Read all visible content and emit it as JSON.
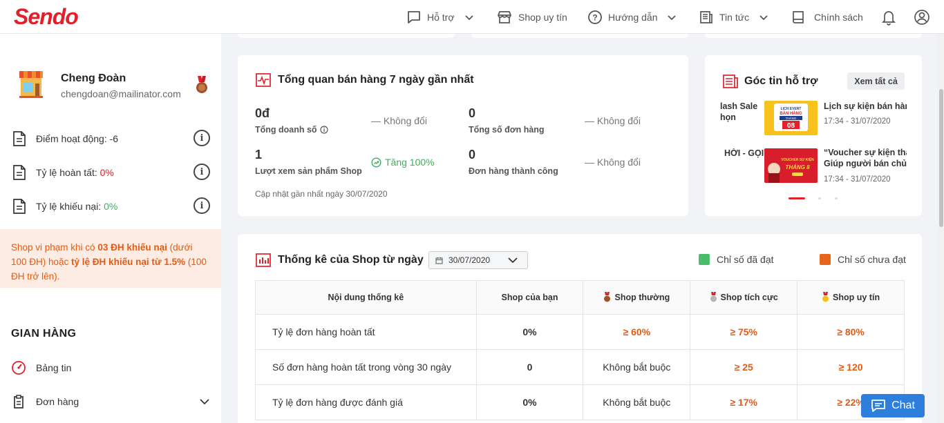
{
  "brand": {
    "logo": "Sendo"
  },
  "header": {
    "nav": [
      {
        "label": "Hỗ trợ"
      },
      {
        "label": "Shop uy tín"
      },
      {
        "label": "Hướng dẫn"
      },
      {
        "label": "Tin tức"
      },
      {
        "label": "Chính sách"
      }
    ]
  },
  "profile": {
    "name": "Cheng Đoàn",
    "email": "chengdoan@mailinator.com"
  },
  "stats": {
    "activity_label": "Điểm hoạt động: ",
    "activity_value": "-6",
    "completion_label": "Tỷ lệ hoàn tất: ",
    "completion_value": "0%",
    "complaint_label": "Tỷ lệ khiếu nại: ",
    "complaint_value": "0%"
  },
  "warning": {
    "p1": "Shop vi phạm khi có ",
    "b1": "03 ĐH khiếu nại",
    "p2": " (dưới 100 ĐH) hoặc ",
    "b2": "tỷ lệ ĐH khiếu nại từ 1.5%",
    "p3": " (100 ĐH trở lên)."
  },
  "sidebar_menu": {
    "section": "GIAN HÀNG",
    "items": [
      {
        "label": "Bảng tin"
      },
      {
        "label": "Đơn hàng"
      }
    ]
  },
  "overview": {
    "title": "Tổng quan bán hàng 7 ngày gần nhất",
    "metrics": [
      {
        "value": "0đ",
        "label": "Tổng doanh số",
        "trend": "— Không đổi"
      },
      {
        "value": "0",
        "label": "Tổng số đơn hàng",
        "trend": "— Không đổi"
      },
      {
        "value": "1",
        "label": "Lượt xem sản phẩm Shop",
        "trend": "Tăng 100%"
      },
      {
        "value": "0",
        "label": "Đơn hàng thành công",
        "trend": "— Không đổi"
      }
    ],
    "updated": "Cập nhật gần nhất ngày 30/07/2020"
  },
  "news": {
    "title": "Góc tin hỗ trợ",
    "see_all": "Xem tất cả",
    "left_snippet_1": "lash Sale",
    "left_snippet_2": "họn",
    "left_snippet_3": "HỜI - GỌI",
    "items": [
      {
        "title": "Lịch sự kiện bán hàn",
        "time": "17:34 - 31/07/2020",
        "thumb_line1": "LỊCH EVENT",
        "thumb_line2": "BÁN HÀNG",
        "thumb_line3": "THÁNG",
        "thumb_num": "08"
      },
      {
        "title": "“Voucher sự kiện tha",
        "title2": "Giúp người bán chủ",
        "time": "17:34 - 31/07/2020",
        "thumb_line1": "VOUCHER SỰ KIỆN",
        "thumb_line2": "THÁNG 8"
      }
    ]
  },
  "shop_stats": {
    "title": "Thống kê của Shop từ ngày",
    "date": "30/07/2020",
    "legend_ok": "Chỉ số đã đạt",
    "legend_not": "Chỉ số chưa đạt",
    "colors": {
      "ok": "#4cbb6c",
      "not": "#e8661b"
    },
    "headers": [
      "Nội dung thống kê",
      "Shop của bạn",
      "Shop thường",
      "Shop tích cực",
      "Shop uy tín"
    ],
    "rows": [
      [
        "Tỷ lệ đơn hàng hoàn tất",
        "0%",
        "≥ 60%",
        "≥ 75%",
        "≥ 80%"
      ],
      [
        "Số đơn hàng hoàn tất trong vòng 30 ngày",
        "0",
        "Không bắt buộc",
        "≥ 25",
        "≥ 120"
      ],
      [
        "Tỷ lệ đơn hàng được đánh giá",
        "0%",
        "Không bắt buộc",
        "≥ 17%",
        "≥ 22%"
      ]
    ]
  },
  "chat": {
    "label": "Chat"
  }
}
